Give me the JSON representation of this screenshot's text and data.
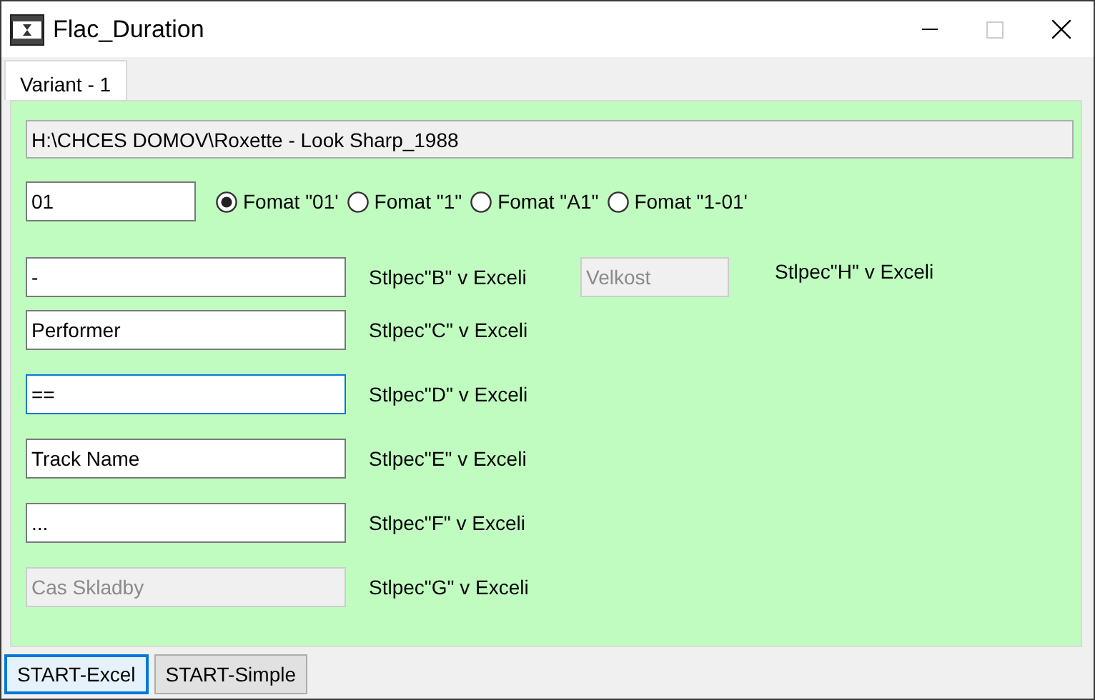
{
  "window": {
    "title": "Flac_Duration",
    "maximize_disabled": true
  },
  "tabs": [
    {
      "label": "Variant - 1",
      "selected": true
    }
  ],
  "path_field": {
    "value": "H:\\CHCES DOMOV\\Roxette - Look Sharp_1988",
    "disabled": true
  },
  "number_field": {
    "value": "01"
  },
  "formats": [
    {
      "label": "Fomat \"01'",
      "selected": true
    },
    {
      "label": "Fomat \"1\"",
      "selected": false
    },
    {
      "label": "Fomat \"A1\"",
      "selected": false
    },
    {
      "label": "Fomat \"1-01'",
      "selected": false
    }
  ],
  "rows": [
    {
      "value": "-",
      "disabled": false,
      "focused": false,
      "label": "Stlpec\"B\" v Exceli",
      "extra_field": {
        "value": "Velkost",
        "disabled": true
      },
      "extra_label": "Stlpec\"H\" v Exceli"
    },
    {
      "value": "Performer",
      "disabled": false,
      "focused": false,
      "label": "Stlpec\"C\" v Exceli"
    },
    {
      "value": "==",
      "disabled": false,
      "focused": true,
      "label": "Stlpec\"D\" v Exceli"
    },
    {
      "value": "Track Name",
      "disabled": false,
      "focused": false,
      "label": "Stlpec\"E\" v Exceli"
    },
    {
      "value": "...",
      "disabled": false,
      "focused": false,
      "label": "Stlpec\"F\" v Exceli"
    },
    {
      "value": "Cas Skladby",
      "disabled": true,
      "focused": false,
      "label": "Stlpec\"G\" v Exceli"
    }
  ],
  "buttons": [
    {
      "label": "START-Excel",
      "selected": true
    },
    {
      "label": "START-Simple",
      "selected": false
    }
  ]
}
